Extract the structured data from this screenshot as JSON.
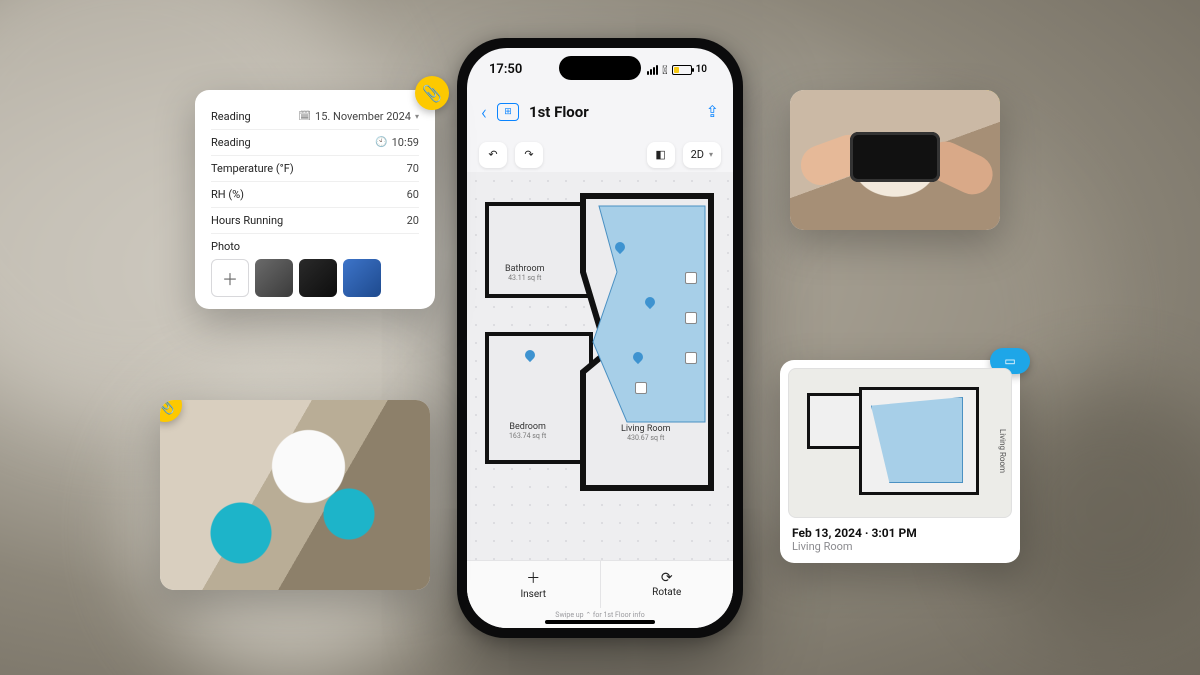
{
  "status": {
    "time": "17:50",
    "battery": "10"
  },
  "nav": {
    "title": "1st Floor"
  },
  "toolbar": {
    "view_mode": "2D"
  },
  "rooms": {
    "bathroom": {
      "name": "Bathroom",
      "area": "43.11 sq ft"
    },
    "bedroom": {
      "name": "Bedroom",
      "area": "163.74 sq ft"
    },
    "living": {
      "name": "Living Room",
      "area": "430.67 sq ft"
    }
  },
  "bottom": {
    "insert": "Insert",
    "rotate": "Rotate",
    "hint": "Swipe up ⌃ for 1st Floor info"
  },
  "readings_card": {
    "rows": [
      {
        "label": "Reading",
        "icon": "calendar",
        "value": "15. November 2024"
      },
      {
        "label": "Reading",
        "icon": "clock",
        "value": "10:59"
      },
      {
        "label": "Temperature (°F)",
        "value": "70"
      },
      {
        "label": "RH (%)",
        "value": "60"
      },
      {
        "label": "Hours Running",
        "value": "20"
      }
    ],
    "photo_label": "Photo"
  },
  "snapshot_card": {
    "timestamp": "Feb 13, 2024 · 3:01 PM",
    "room": "Living Room",
    "side_label": "Living Room"
  }
}
